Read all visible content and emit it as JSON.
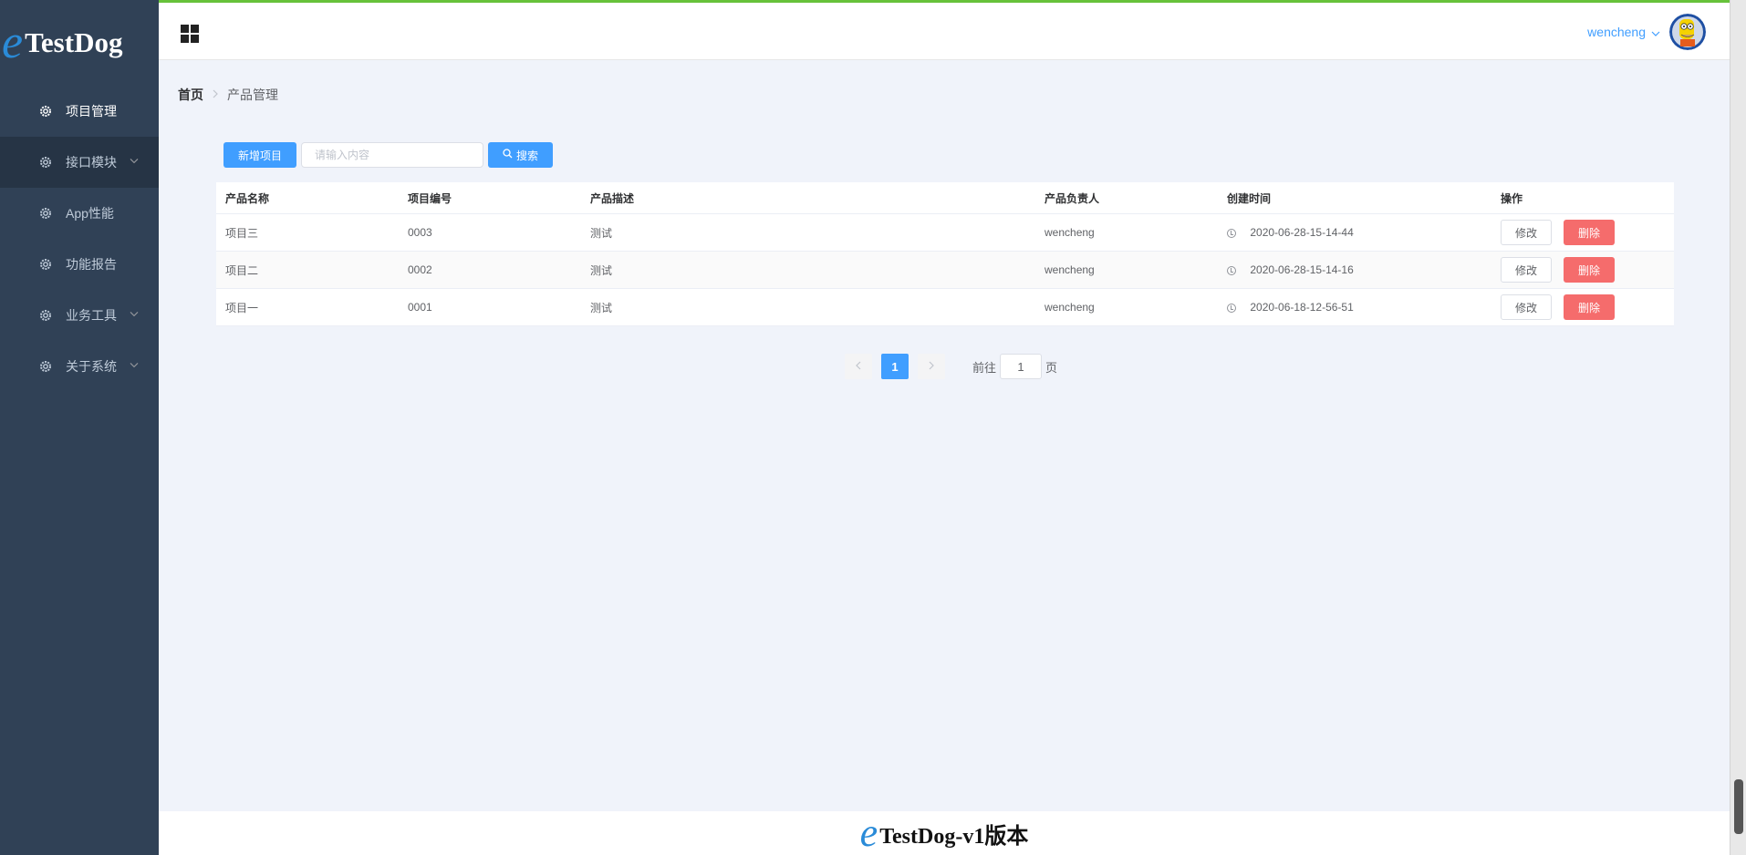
{
  "brand": {
    "logo_letter": "e",
    "logo_text": "TestDog"
  },
  "sidebar": {
    "items": [
      {
        "label": "项目管理",
        "icon": "gear-icon",
        "active": true,
        "expandable": false
      },
      {
        "label": "接口模块",
        "icon": "gear-icon",
        "active": false,
        "expandable": true
      },
      {
        "label": "App性能",
        "icon": "gear-icon",
        "active": false,
        "expandable": false
      },
      {
        "label": "功能报告",
        "icon": "gear-icon",
        "active": false,
        "expandable": false
      },
      {
        "label": "业务工具",
        "icon": "gear-icon",
        "active": false,
        "expandable": true
      },
      {
        "label": "关于系统",
        "icon": "gear-icon",
        "active": false,
        "expandable": true
      }
    ]
  },
  "header": {
    "username": "wencheng",
    "accent_color": "#67c23a"
  },
  "breadcrumb": {
    "home": "首页",
    "current": "产品管理"
  },
  "toolbar": {
    "add_label": "新增项目",
    "search_placeholder": "请输入内容",
    "search_label": "搜索"
  },
  "table": {
    "columns": [
      "产品名称",
      "项目编号",
      "产品描述",
      "产品负责人",
      "创建时间",
      "操作"
    ],
    "rows": [
      {
        "name": "项目三",
        "code": "0003",
        "desc": "测试",
        "owner": "wencheng",
        "created": "2020-06-28-15-14-44"
      },
      {
        "name": "项目二",
        "code": "0002",
        "desc": "测试",
        "owner": "wencheng",
        "created": "2020-06-28-15-14-16"
      },
      {
        "name": "项目一",
        "code": "0001",
        "desc": "测试",
        "owner": "wencheng",
        "created": "2020-06-18-12-56-51"
      }
    ],
    "edit_label": "修改",
    "delete_label": "删除"
  },
  "pagination": {
    "current_page": "1",
    "goto_prefix": "前往",
    "goto_value": "1",
    "goto_suffix": "页"
  },
  "footer": {
    "logo_letter": "e",
    "text": "TestDog-v1版本"
  },
  "colors": {
    "primary": "#409eff",
    "danger": "#f56c6c",
    "sidebar_bg": "#304156",
    "page_bg": "#f0f3fa"
  }
}
